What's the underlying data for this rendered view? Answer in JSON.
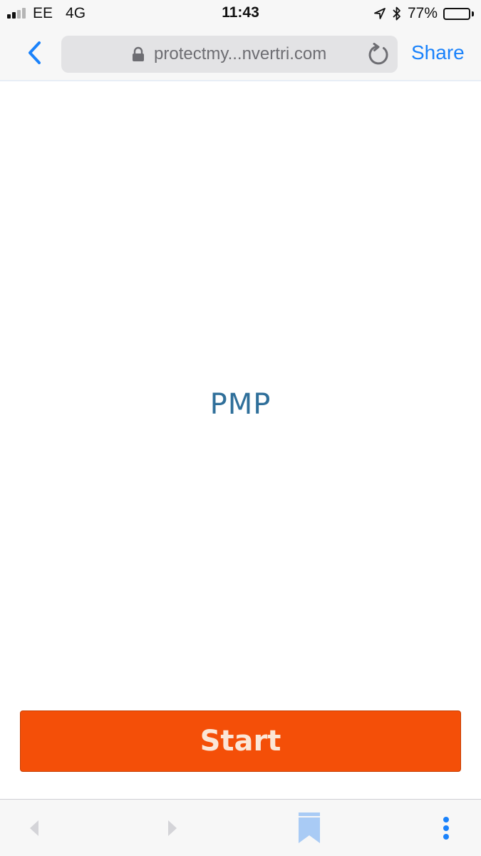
{
  "status_bar": {
    "carrier": "EE",
    "network": "4G",
    "time": "11:43",
    "battery_percent_label": "77%",
    "battery_level": 0.77,
    "signal_bars_filled": 2,
    "signal_bars_total": 4,
    "icons": [
      "signal-icon",
      "location-arrow-icon",
      "bluetooth-icon",
      "battery-icon"
    ]
  },
  "nav_bar": {
    "url_display": "protectmy...nvertri.com",
    "share_label": "Share",
    "icons": [
      "back-chevron-icon",
      "lock-icon",
      "reload-icon"
    ]
  },
  "page": {
    "title": "PMP",
    "start_label": "Start"
  },
  "toolbar": {
    "icons": [
      "back-arrow-icon",
      "forward-arrow-icon",
      "bookmarks-icon",
      "more-menu-icon"
    ]
  },
  "colors": {
    "accent_blue": "#1a82fb",
    "title_blue": "#2f6f9a",
    "start_orange": "#f44f08",
    "bookmark_blue": "#a9cbf5"
  }
}
